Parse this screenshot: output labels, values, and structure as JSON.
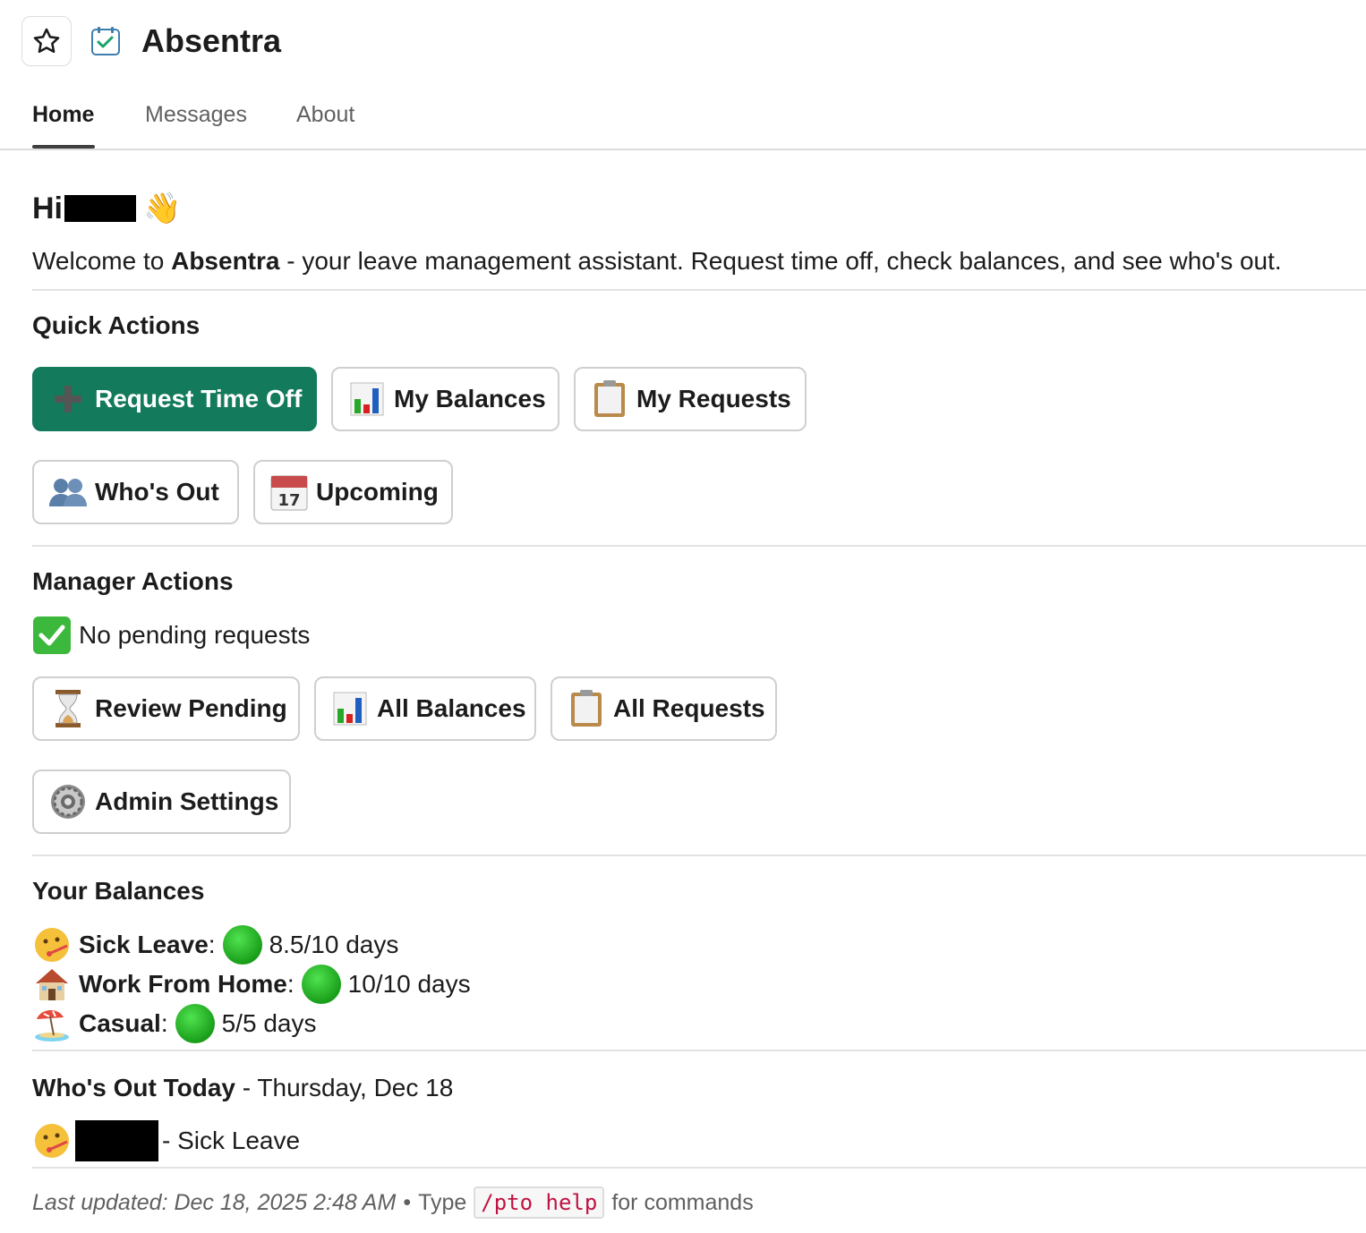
{
  "header": {
    "title": "Absentra",
    "star_icon": "star-outline-icon",
    "app_icon": "calendar-check-icon"
  },
  "tabs": [
    {
      "label": "Home",
      "active": true
    },
    {
      "label": "Messages",
      "active": false
    },
    {
      "label": "About",
      "active": false
    }
  ],
  "greeting": {
    "prefix": "Hi",
    "emoji": "👋"
  },
  "welcome": {
    "before": "Welcome to ",
    "app_name": "Absentra",
    "after": " - your leave management assistant. Request time off, check balances, and see who's out."
  },
  "quick_actions": {
    "title": "Quick Actions",
    "buttons": [
      {
        "label": "Request Time Off",
        "icon": "plus-icon",
        "primary": true
      },
      {
        "label": "My Balances",
        "icon": "bar-chart-icon"
      },
      {
        "label": "My Requests",
        "icon": "clipboard-icon"
      },
      {
        "label": "Who's Out",
        "icon": "people-icon"
      },
      {
        "label": "Upcoming",
        "icon": "calendar-icon"
      }
    ]
  },
  "manager_actions": {
    "title": "Manager Actions",
    "status": "No pending requests",
    "buttons": [
      {
        "label": "Review Pending",
        "icon": "hourglass-icon"
      },
      {
        "label": "All Balances",
        "icon": "bar-chart-icon"
      },
      {
        "label": "All Requests",
        "icon": "clipboard-icon"
      },
      {
        "label": "Admin Settings",
        "icon": "gear-icon"
      }
    ]
  },
  "balances": {
    "title": "Your Balances",
    "items": [
      {
        "name": "Sick Leave",
        "value": "8.5/10 days",
        "icon": "thermometer-face-icon"
      },
      {
        "name": "Work From Home",
        "value": "10/10 days",
        "icon": "house-icon"
      },
      {
        "name": "Casual",
        "value": "5/5 days",
        "icon": "beach-umbrella-icon"
      }
    ]
  },
  "whos_out": {
    "title": "Who's Out Today",
    "date": " - Thursday, Dec 18",
    "entries": [
      {
        "leave_type": "- Sick Leave",
        "icon": "thermometer-face-icon"
      }
    ]
  },
  "footer": {
    "updated": "Last updated: Dec 18, 2025 2:48 AM",
    "bullet": "•",
    "type_label": "Type",
    "command": "/pto help",
    "suffix": "for commands"
  },
  "colors": {
    "primary_button": "#147a5c",
    "code_text": "#c01343"
  }
}
